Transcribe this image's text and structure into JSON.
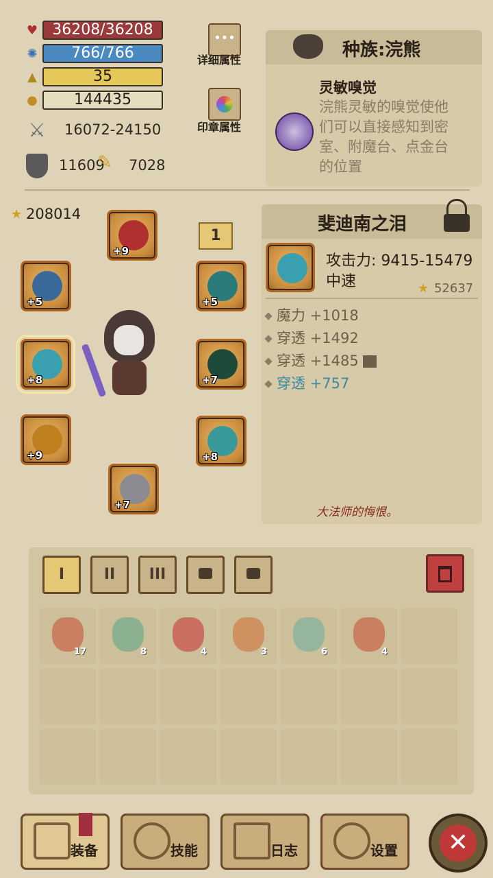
{
  "stats": {
    "hp": "36208/36208",
    "mp": "766/766",
    "level": "35",
    "gold": "144435",
    "attack": "16072-24150",
    "armor": "11609",
    "magic": "7028"
  },
  "buttons": {
    "detail_attributes": "详细属性",
    "seal_attributes": "印章属性"
  },
  "race": {
    "title": "种族:浣熊",
    "trait_name": "灵敏嗅觉",
    "trait_desc": "浣熊灵敏的嗅觉使他们可以直接感知到密室、附魔台、点金台的位置"
  },
  "character": {
    "power": "208014",
    "slot_levels": [
      "+9",
      "+5",
      "+5",
      "+8",
      "+7",
      "+9",
      "+8",
      "+7"
    ],
    "page_badge": "1"
  },
  "item": {
    "name": "斐迪南之泪",
    "attack": "攻击力: 9415-15479",
    "speed": "中速",
    "power": "52637",
    "affixes": [
      {
        "label": "魔力",
        "value": "+1018"
      },
      {
        "label": "穿透",
        "value": "+1492"
      },
      {
        "label": "穿透",
        "value": "+1485"
      },
      {
        "label": "穿透",
        "value": "+757"
      }
    ],
    "flavor": "大法师的悔恨。"
  },
  "bag_tabs": [
    "I",
    "II",
    "III"
  ],
  "inventory": [
    {
      "count": "17",
      "color": "#c8553a"
    },
    {
      "count": "8",
      "color": "#5fa98a"
    },
    {
      "count": "4",
      "color": "#c83a3a"
    },
    {
      "count": "3",
      "color": "#d0733a"
    },
    {
      "count": "6",
      "color": "#6fb0a0"
    },
    {
      "count": "4",
      "color": "#c8553a"
    }
  ],
  "nav": {
    "equipment": "装备",
    "skills": "技能",
    "log": "日志",
    "settings": "设置"
  },
  "colors": {
    "hp_bar": "#9a3a3a",
    "mp_bar": "#4a8ac0",
    "level_bar": "#e6c75a",
    "gold_bar": "#e6dcc0",
    "affix_highlight": "#3a8aa0"
  }
}
